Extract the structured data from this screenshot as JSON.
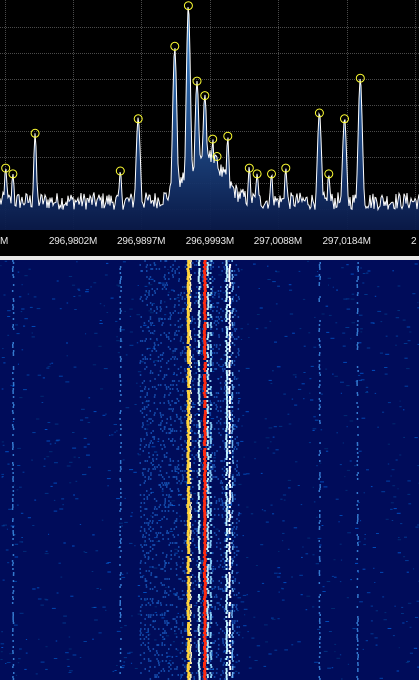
{
  "app": {
    "view": "spectrum-waterfall"
  },
  "colors": {
    "background": "#000000",
    "grid": "#4a4a4a",
    "trace": "#ffffff",
    "fill_top": "#3d8fe0",
    "fill_bottom": "#0a1a4a",
    "peak_marker": "#ffff33",
    "waterfall_bg": "#000c5a",
    "waterfall_hot": "#ff2a10",
    "waterfall_warm": "#ffd23a",
    "waterfall_cool": "#bff2ff"
  },
  "frequency_axis": {
    "labels": [
      {
        "text": "M",
        "freq": 296.9707
      },
      {
        "text": "296,9802M",
        "freq": 296.9802
      },
      {
        "text": "296,9897M",
        "freq": 296.9897
      },
      {
        "text": "296,9993M",
        "freq": 296.9993
      },
      {
        "text": "297,0088M",
        "freq": 297.0088
      },
      {
        "text": "297,0184M",
        "freq": 297.0184
      },
      {
        "text": "2",
        "freq": 297.0279
      }
    ],
    "unit": "MHz"
  },
  "chart_data": {
    "type": "area",
    "x_range_mhz": [
      296.97,
      297.0285
    ],
    "peaks_mhz": [
      296.9708,
      296.9718,
      296.9749,
      296.9868,
      296.9893,
      296.9944,
      296.9963,
      296.9975,
      296.9986,
      296.9997,
      297.0003,
      297.0018,
      297.0048,
      297.0059,
      297.0079,
      297.0099,
      297.0146,
      297.0159,
      297.0181,
      297.0203
    ],
    "peak_levels": [
      0.21,
      0.19,
      0.33,
      0.2,
      0.38,
      0.63,
      0.77,
      0.51,
      0.46,
      0.31,
      0.25,
      0.32,
      0.21,
      0.19,
      0.19,
      0.21,
      0.4,
      0.19,
      0.38,
      0.52
    ],
    "noise_floor": 0.07,
    "grid": true
  },
  "waterfall": {
    "strong_signals_mhz": [
      296.9963,
      296.9978,
      296.9986,
      297.0018
    ],
    "weak_signals_mhz": [
      296.9718,
      296.9868,
      297.0146,
      297.0199
    ]
  }
}
